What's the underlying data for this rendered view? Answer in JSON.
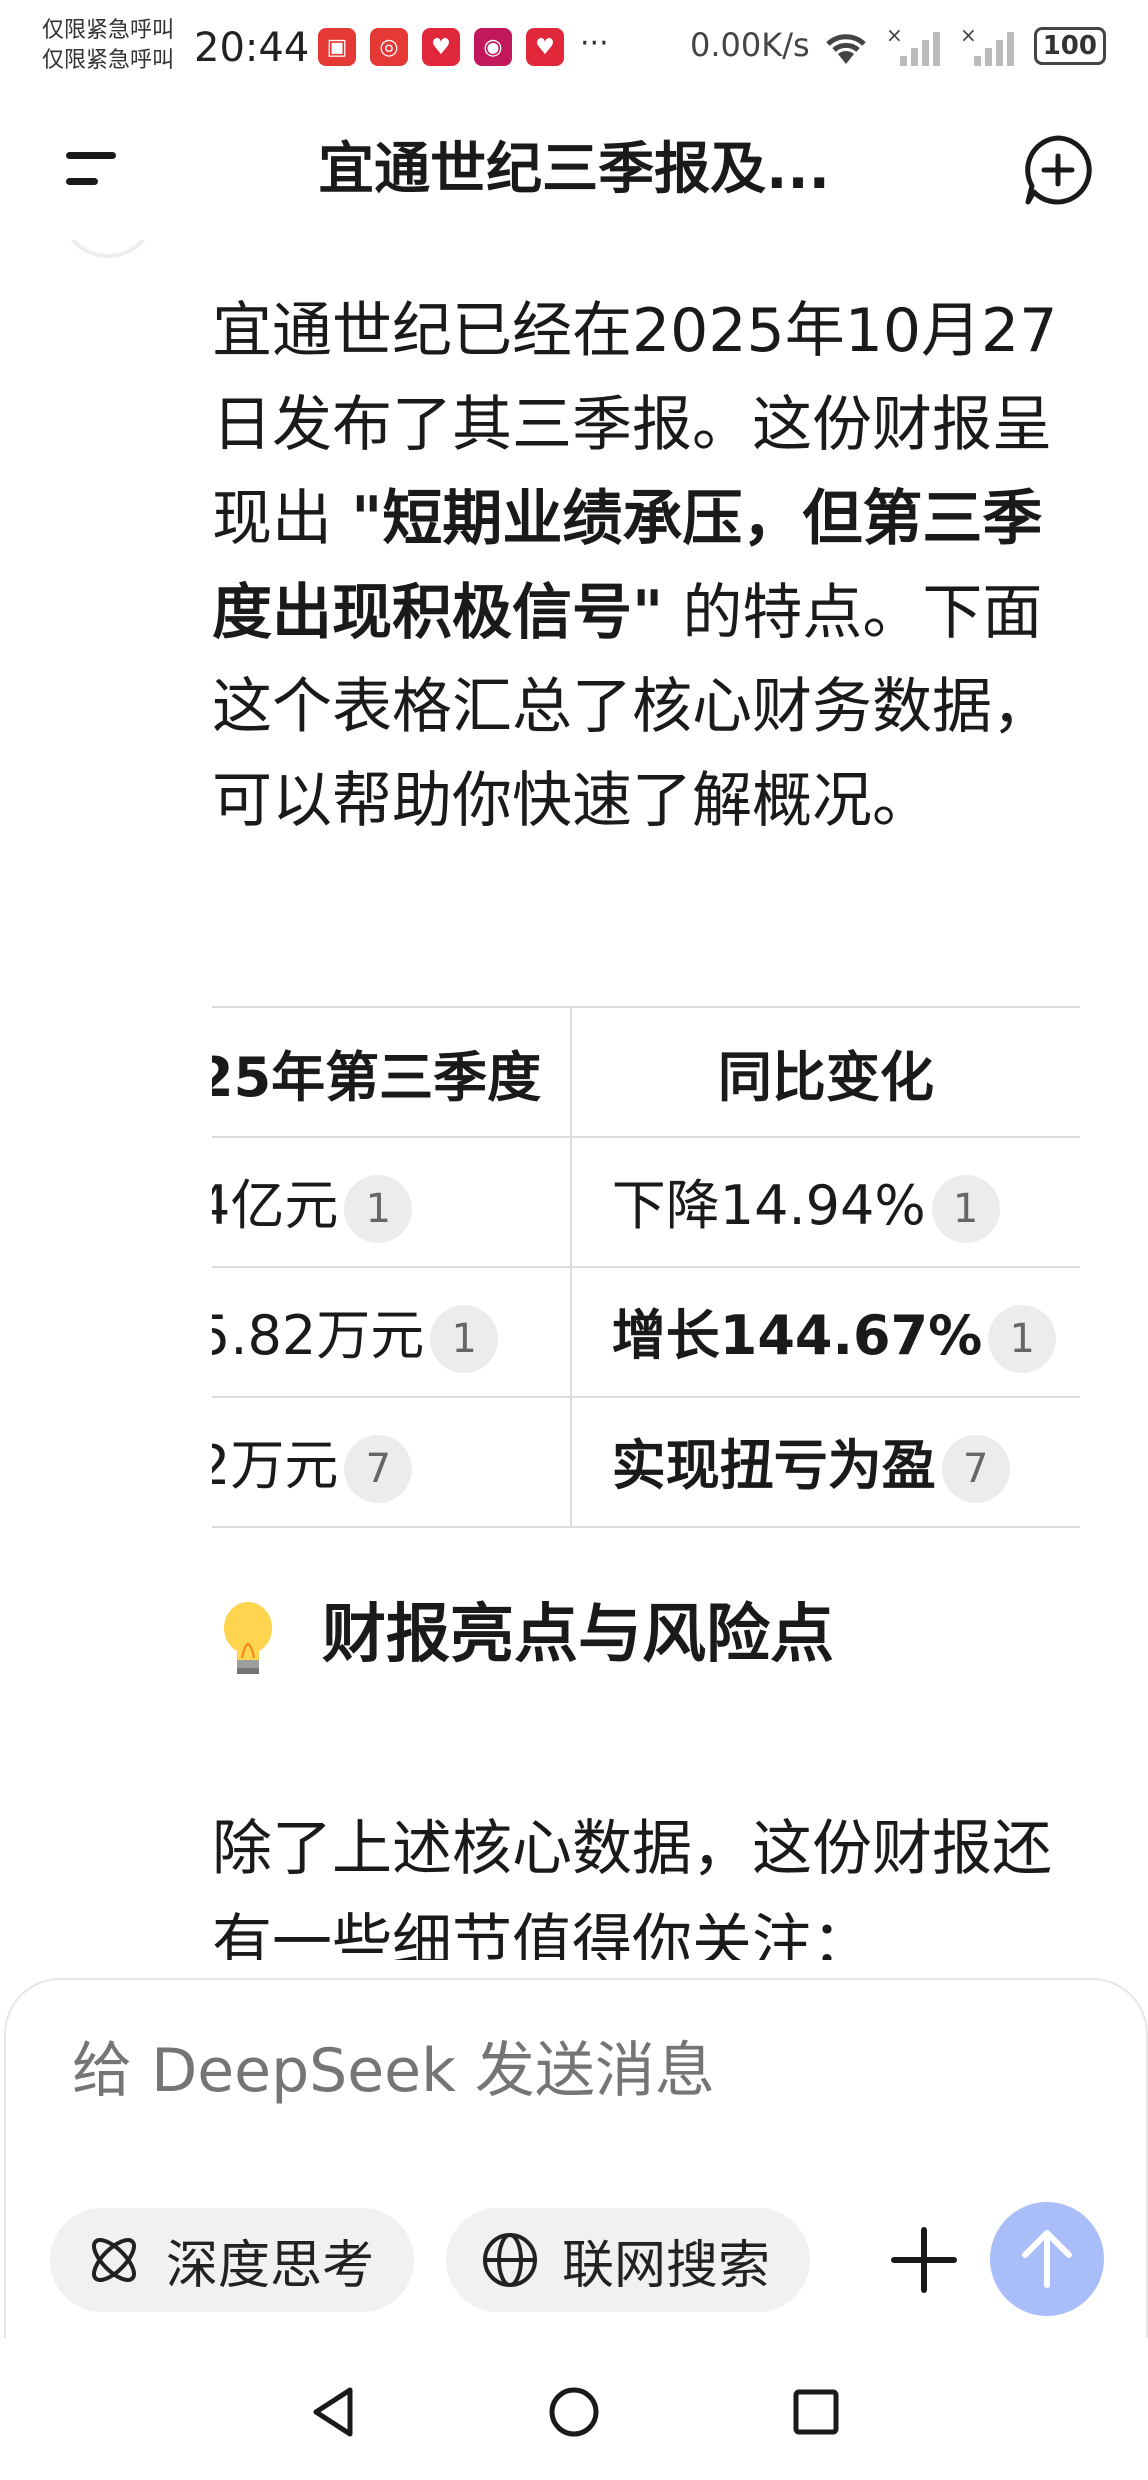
{
  "status_bar": {
    "carrier_line1": "仅限紧急呼叫",
    "carrier_line2": "仅限紧急呼叫",
    "time": "20:44",
    "more": "···",
    "net_speed": "0.00K/s",
    "battery": "100",
    "app_icons": [
      "huawei-video-icon",
      "weibo-icon",
      "pinduoduo-icon",
      "tmall-icon",
      "pinduoduo-icon"
    ]
  },
  "header": {
    "title": "宜通世纪三季报及..."
  },
  "message": {
    "p1_part1": "宜通世纪已经在2025年10月27日发布了其三季报。这份财报呈现出 ",
    "p1_bold": "\"短期业绩承压，但第三季度出现积极信号\"",
    "p1_part2": " 的特点。下面这个表格汇总了核心财务数据，可以帮助你快速了解概况。",
    "table": {
      "headers": [
        "25年第三季度",
        "同比变化"
      ],
      "rows": [
        {
          "c1": "4亿元",
          "c1_cite": "1",
          "c2": "下降14.94%",
          "c2_bold": false,
          "c2_cite": "1"
        },
        {
          "c1": "5.82万元",
          "c1_cite": "1",
          "c2": "增长144.67%",
          "c2_bold": true,
          "c2_cite": "1"
        },
        {
          "c1": "2万元",
          "c1_cite": "7",
          "c2": "实现扭亏为盈",
          "c2_bold": true,
          "c2_cite": "7"
        }
      ]
    },
    "heading": "财报亮点与风险点",
    "p2": "除了上述核心数据，这份财报还有一些细节值得你关注："
  },
  "composer": {
    "placeholder": "给 DeepSeek 发送消息",
    "deep_think_label": "深度思考",
    "web_search_label": "联网搜索"
  },
  "colors": {
    "send_button": "#a9bdf9",
    "chip_bg": "#f1f1f1",
    "placeholder": "#a8a8a8"
  }
}
